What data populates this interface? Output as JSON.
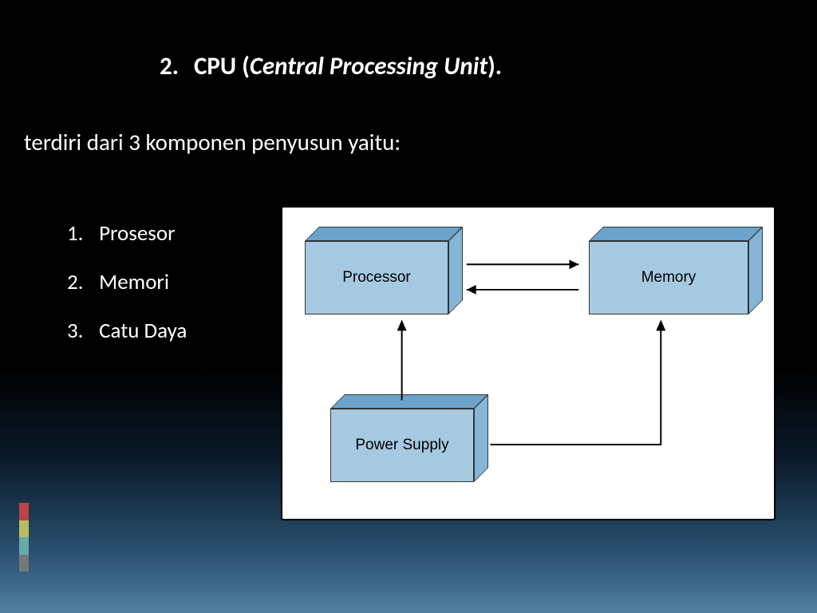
{
  "title": {
    "number": "2.",
    "abbr": "CPU",
    "open_paren": "(",
    "fullname": "Central Processing Unit",
    "close_paren": ")."
  },
  "subtitle": "terdiri dari 3 komponen penyusun yaitu:",
  "components": [
    {
      "n": "1.",
      "label": "Prosesor"
    },
    {
      "n": "2.",
      "label": "Memori"
    },
    {
      "n": "3.",
      "label": "Catu Daya"
    }
  ],
  "diagram": {
    "processor": "Processor",
    "memory": "Memory",
    "power": "Power Supply"
  }
}
